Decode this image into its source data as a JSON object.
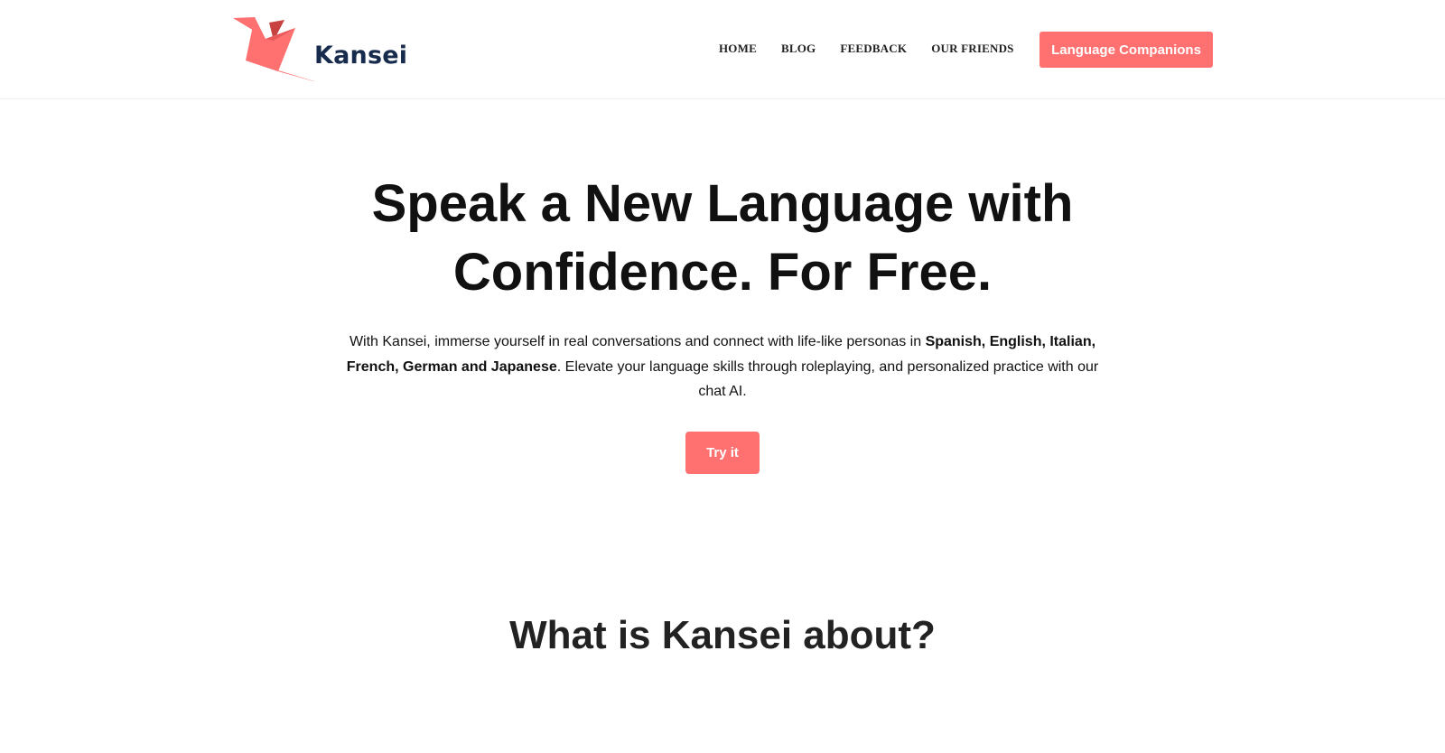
{
  "brand": {
    "name": "Kansei",
    "logo_icon": "origami-crane-icon",
    "accent_color": "#ff7070",
    "text_color": "#172b4d"
  },
  "nav": {
    "items": [
      "HOME",
      "BLOG",
      "FEEDBACK",
      "OUR FRIENDS"
    ],
    "cta_label": "Language Companions"
  },
  "hero": {
    "title_line1": "Speak a New Language with",
    "title_line2": "Confidence. For Free.",
    "text_part1": "With Kansei, immerse yourself in real conversations and connect with life-like personas in ",
    "text_bold": "Spanish, English, Italian, French, German and Japanese",
    "text_part2": ". Elevate your language skills through roleplaying, and personalized practice with our chat AI.",
    "button_label": "Try it"
  },
  "about": {
    "title": "What is Kansei about?"
  }
}
